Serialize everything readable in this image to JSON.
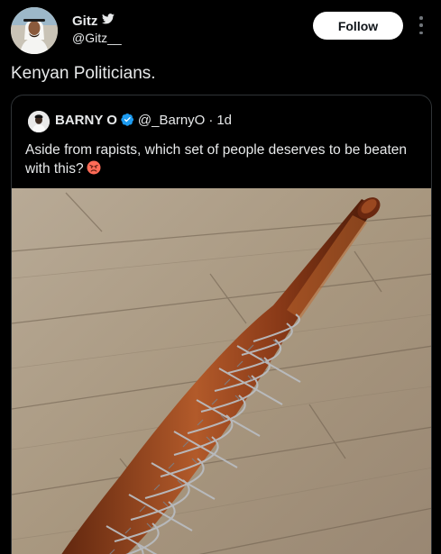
{
  "author": {
    "display_name": "Gitz",
    "handle": "@Gitz__",
    "avatar_icon": "profile-photo",
    "bird_icon": "twitter-bird-icon"
  },
  "actions": {
    "follow_label": "Follow",
    "more_icon": "vertical-ellipsis-icon"
  },
  "tweet": {
    "text": "Kenyan Politicians."
  },
  "quoted_tweet": {
    "display_name": "BARNY O",
    "verified_icon": "verified-badge-icon",
    "handle": "@_BarnyO",
    "separator": "·",
    "time": "1d",
    "text": "Aside from rapists, which set of people deserves to be beaten with this?",
    "emoji": "angry-face-emoji",
    "image": "barbed-wire-wrapped-baseball-bat-on-wooden-floor"
  },
  "colors": {
    "background": "#000000",
    "text": "#e7e9ea",
    "border": "#2f3336",
    "verified": "#1d9bf0",
    "follow_bg": "#ffffff"
  }
}
